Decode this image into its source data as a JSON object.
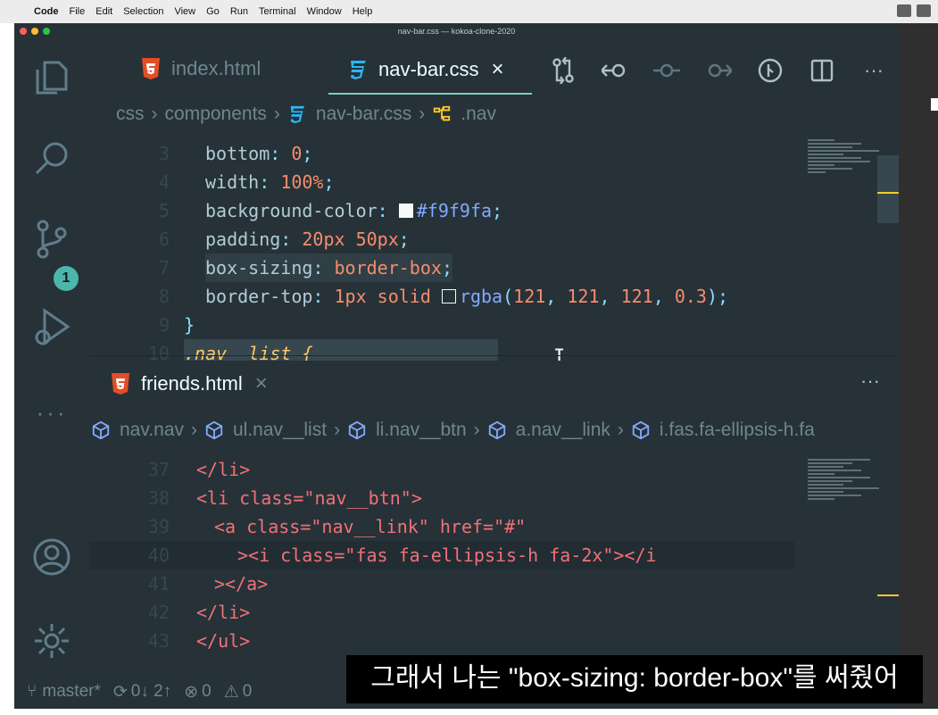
{
  "menubar": {
    "items": [
      "Code",
      "File",
      "Edit",
      "Selection",
      "View",
      "Go",
      "Run",
      "Terminal",
      "Window",
      "Help"
    ]
  },
  "window": {
    "title": "nav-bar.css — kokoa-clone-2020"
  },
  "activity": {
    "scm_badge": "1"
  },
  "top_group": {
    "tabs": [
      {
        "label": "index.html",
        "icon": "html5-icon",
        "active": false
      },
      {
        "label": "nav-bar.css",
        "icon": "css3-icon",
        "active": true,
        "close": "×"
      }
    ],
    "breadcrumb": [
      "css",
      "components",
      "nav-bar.css",
      ".nav"
    ],
    "lines": [
      {
        "n": "3",
        "prop": "bottom",
        "val": "0"
      },
      {
        "n": "4",
        "prop": "width",
        "val": "100%"
      },
      {
        "n": "5",
        "prop": "background-color",
        "val": "#f9f9fa"
      },
      {
        "n": "6",
        "prop": "padding",
        "val": "20px 50px"
      },
      {
        "n": "7",
        "prop": "box-sizing",
        "val": "border-box"
      },
      {
        "n": "8",
        "prop": "border-top",
        "val": "1px solid",
        "fn": "rgba",
        "args": [
          "121",
          "121",
          "121",
          "0.3"
        ]
      },
      {
        "n": "9",
        "close": "}"
      },
      {
        "n": "10",
        "peek": ".nav__list {"
      }
    ]
  },
  "bottom_group": {
    "tab": {
      "label": "friends.html",
      "icon": "html5-icon",
      "close": "×"
    },
    "more": "···",
    "breadcrumb": [
      "nav.nav",
      "ul.nav__list",
      "li.nav__btn",
      "a.nav__link",
      "i.fas.fa-ellipsis-h.fa"
    ],
    "lines": [
      {
        "n": "37",
        "code": "</li>"
      },
      {
        "n": "38",
        "code": "<li class=\"nav__btn\">"
      },
      {
        "n": "39",
        "code": "<a class=\"nav__link\" href=\"#\""
      },
      {
        "n": "40",
        "code": "><i class=\"fas fa-ellipsis-h fa-2x\"></i"
      },
      {
        "n": "41",
        "code": "></a>"
      },
      {
        "n": "42",
        "code": "</li>"
      },
      {
        "n": "43",
        "code": "</ul>"
      }
    ]
  },
  "statusbar": {
    "branch": "master*",
    "sync": "0↓ 2↑",
    "errors": "0",
    "warnings": "0"
  },
  "subtitle": "그래서 나는 \"box-sizing: border-box\"를 써줬어",
  "colors": {
    "editor_bg": "#263238",
    "accent": "#80cbc4",
    "badge": "#4db6ac",
    "scroll_mark": "#ffca28"
  }
}
